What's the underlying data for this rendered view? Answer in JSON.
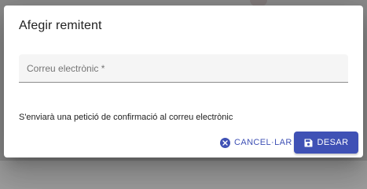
{
  "dialog": {
    "title": "Afegir remitent",
    "email_placeholder": "Correu electrònic *",
    "email_value": "",
    "helper_text": "S'enviarà una petició de confirmació al correu electrònic",
    "cancel_label": "CANCEL·LAR",
    "save_label": "DESAR"
  },
  "icons": {
    "cancel": "cancel-circle-icon",
    "save": "floppy-disk-icon"
  },
  "colors": {
    "primary": "#3f51b5",
    "field_background": "#f5f5f5",
    "backdrop": "#8a8a8a"
  }
}
